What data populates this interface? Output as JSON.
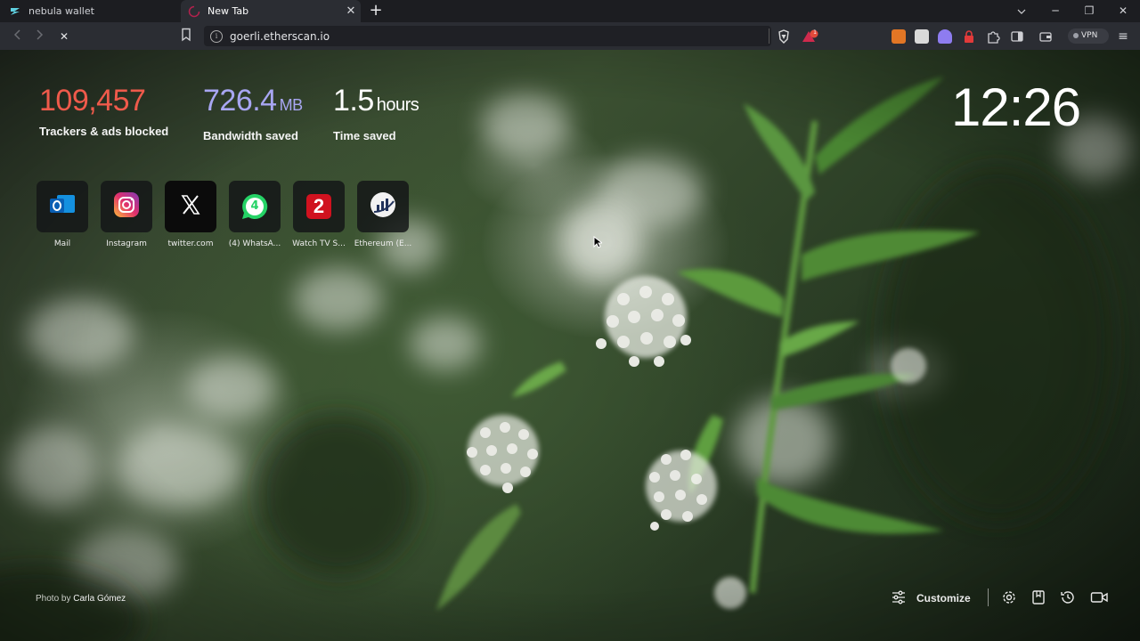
{
  "tabs": [
    {
      "title": "nebula wallet",
      "active": false,
      "favicon": "nebula-logo-icon"
    },
    {
      "title": "New Tab",
      "active": true,
      "favicon": "loading-spinner-icon"
    }
  ],
  "toolbar": {
    "url": "goerli.etherscan.io",
    "vpn_label": "VPN",
    "shield_badge": "1"
  },
  "stats": {
    "trackers": {
      "value": "109,457",
      "label": "Trackers & ads blocked",
      "color": "#ef5a4b"
    },
    "bandwidth": {
      "value": "726.4",
      "unit": "MB",
      "label": "Bandwidth saved",
      "color": "#a8a6f2"
    },
    "time": {
      "value": "1.5",
      "unit": "hours",
      "label": "Time saved",
      "color": "#ffffff"
    }
  },
  "clock": "12:26",
  "shortcuts": [
    {
      "name": "Mail",
      "icon": "outlook-icon"
    },
    {
      "name": "Instagram",
      "icon": "instagram-icon"
    },
    {
      "name": "twitter.com",
      "icon": "x-icon"
    },
    {
      "name": "(4) WhatsA...",
      "icon": "whatsapp-icon",
      "badge": "4"
    },
    {
      "name": "Watch TV S...",
      "icon": "channel2-icon",
      "badge": "2"
    },
    {
      "name": "Ethereum (E...",
      "icon": "etherscan-icon"
    }
  ],
  "footer": {
    "credit_prefix": "Photo by",
    "credit_name": "Carla Gómez",
    "customize_label": "Customize"
  }
}
